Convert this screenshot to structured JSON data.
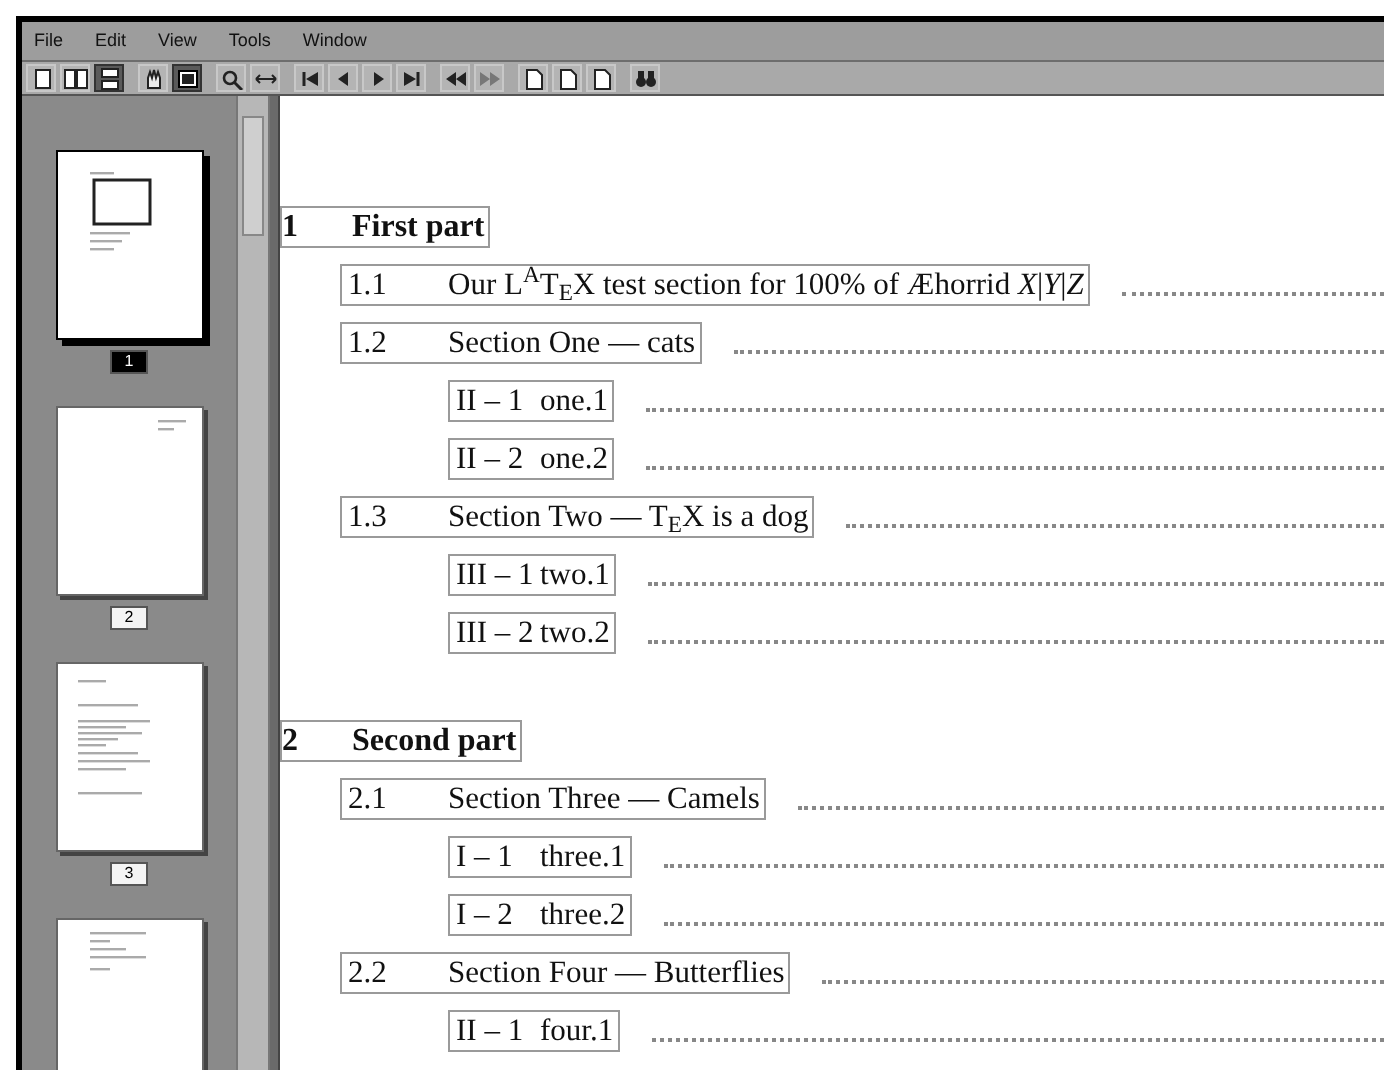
{
  "menu": [
    "File",
    "Edit",
    "View",
    "Tools",
    "Window"
  ],
  "toolbar": [
    {
      "kind": "single",
      "pressed": false
    },
    {
      "kind": "double",
      "pressed": false
    },
    {
      "kind": "continuous",
      "pressed": true
    },
    {
      "kind": "hand",
      "pressed": false
    },
    {
      "kind": "select",
      "pressed": true
    },
    {
      "kind": "zoom",
      "pressed": false
    },
    {
      "kind": "fitwidth",
      "pressed": false
    },
    {
      "kind": "first",
      "pressed": false
    },
    {
      "kind": "prev",
      "pressed": false
    },
    {
      "kind": "next",
      "pressed": false
    },
    {
      "kind": "last",
      "pressed": false
    },
    {
      "kind": "back",
      "pressed": false
    },
    {
      "kind": "forward",
      "pressed": false
    },
    {
      "kind": "page",
      "pressed": false
    },
    {
      "kind": "page",
      "pressed": false
    },
    {
      "kind": "page",
      "pressed": false
    },
    {
      "kind": "find",
      "pressed": false
    }
  ],
  "thumbnails": [
    {
      "label": "1",
      "selected": true,
      "kind": "toc"
    },
    {
      "label": "2",
      "selected": false,
      "kind": "blank"
    },
    {
      "label": "3",
      "selected": false,
      "kind": "text"
    },
    {
      "selected": false,
      "kind": "sparse"
    }
  ],
  "toc": [
    {
      "number": "1",
      "title": "First part",
      "children": [
        {
          "number": "1.1",
          "title": "Our L$^{A}$T$_{E}$X test section for 100% of Æhorrid *X*|*Y*|*Z*"
        },
        {
          "number": "1.2",
          "title": "Section One — cats",
          "children": [
            {
              "number": "II – 1",
              "title": "one.1"
            },
            {
              "number": "II – 2",
              "title": "one.2"
            }
          ]
        },
        {
          "number": "1.3",
          "title": "Section Two — T$_{E}$X is a dog",
          "children": [
            {
              "number": "III – 1",
              "title": "two.1"
            },
            {
              "number": "III – 2",
              "title": "two.2"
            }
          ]
        }
      ]
    },
    {
      "number": "2",
      "title": "Second part",
      "children": [
        {
          "number": "2.1",
          "title": "Section Three — Camels",
          "children": [
            {
              "number": "I – 1",
              "title": "three.1"
            },
            {
              "number": "I – 2",
              "title": "three.2"
            }
          ]
        },
        {
          "number": "2.2",
          "title": "Section Four — Butterflies",
          "children": [
            {
              "number": "II – 1",
              "title": "four.1"
            }
          ]
        }
      ]
    }
  ]
}
